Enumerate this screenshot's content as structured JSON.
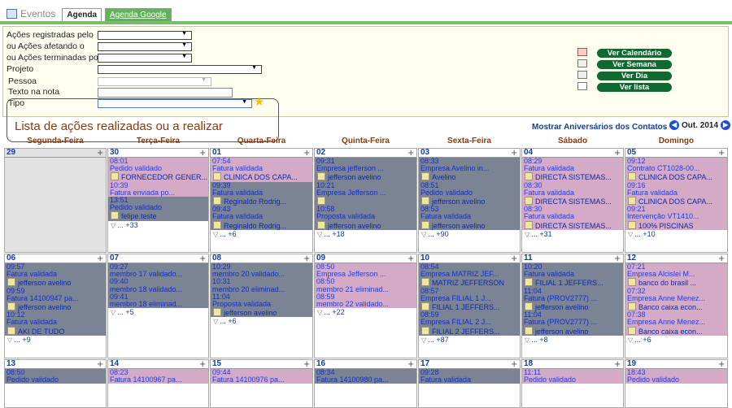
{
  "tabs": {
    "eventos": "Eventos",
    "agenda": "Agenda",
    "google": "Agenda Google"
  },
  "filters": {
    "registradas": "Ações registradas pelo",
    "afetando": "ou Ações afetando o",
    "terminadas": "ou Ações terminadas por",
    "projeto": "Projeto",
    "pessoa": "Pessoa",
    "texto": "Texto na nota",
    "tipo": "Tipo"
  },
  "views": [
    "Ver Calendário",
    "Ver Semana",
    "Ver Dia",
    "Ver lista"
  ],
  "list_title": "Lista de ações realizadas ou a realizar",
  "aniversarios": "Mostrar Aniversários dos Contatos",
  "month": "Out. 2014",
  "weekdays": [
    "Segunda-Feira",
    "Terça-Feira",
    "Quarta-Feira",
    "Quinta-Feira",
    "Sexta-Feira",
    "Sábado",
    "Domingo"
  ],
  "weeks": [
    [
      {
        "day": "29",
        "gray": true,
        "events": [],
        "more": ""
      },
      {
        "day": "30",
        "events": [
          {
            "c": "pink",
            "t": "08:01",
            "d": "Pedido validado",
            "w": "FORNECEDOR GENER..."
          },
          {
            "c": "pink",
            "t": "10:39",
            "d": "Fatura enviada po..."
          },
          {
            "c": "blue",
            "t": "13:51",
            "d": "Pedido validado",
            "w": "felipe.teste"
          }
        ],
        "more": "... +33"
      },
      {
        "day": "01",
        "events": [
          {
            "c": "pink",
            "t": "07:54",
            "d": "Fatura validada",
            "w": "CLINICA DOS CAPA..."
          },
          {
            "c": "blue",
            "t": "09:39",
            "d": "Fatura validada",
            "w": "Reginaldo Rodrig..."
          },
          {
            "c": "blue",
            "t": "09:43",
            "d": "Fatura validada",
            "w": "Reginaldo Rodrig..."
          }
        ],
        "more": "... +6"
      },
      {
        "day": "02",
        "events": [
          {
            "c": "blue",
            "t": "09:31",
            "d": "Empresa jefferson ...",
            "w": "jefferson avelino"
          },
          {
            "c": "blue",
            "t": "10:21",
            "d": "Empresa Jefferson ...",
            "w": " "
          },
          {
            "c": "blue",
            "t": "10:58",
            "d": "Proposta validada",
            "w": "jefferson avelino"
          }
        ],
        "more": "... +18"
      },
      {
        "day": "03",
        "events": [
          {
            "c": "blue",
            "t": "08:33",
            "d": "Empresa Avelino in...",
            "w": "Avelino"
          },
          {
            "c": "blue",
            "t": "08:51",
            "d": "Pedido validado",
            "w": "jefferson avelino"
          },
          {
            "c": "blue",
            "t": "08:53",
            "d": "Fatura validada",
            "w": "jefferson avelino"
          }
        ],
        "more": "... +90"
      },
      {
        "day": "04",
        "events": [
          {
            "c": "pink",
            "t": "08:29",
            "d": "Fatura validada",
            "w": "DIRECTA SISTEMAS..."
          },
          {
            "c": "pink",
            "t": "08:30",
            "d": "Fatura validada",
            "w": "DIRECTA SISTEMAS..."
          },
          {
            "c": "pink",
            "t": "08:30",
            "d": "Fatura validada",
            "w": "DIRECTA SISTEMAS..."
          }
        ],
        "more": "... +31"
      },
      {
        "day": "05",
        "events": [
          {
            "c": "pink",
            "t": "09:12",
            "d": "Contrato CT1028-00...",
            "w": "CLINICA DOS CAPA..."
          },
          {
            "c": "pink",
            "t": "09:16",
            "d": "Fatura validada",
            "w": "CLINICA DOS CAPA..."
          },
          {
            "c": "pink",
            "t": "09:21",
            "d": "Intervenção VT1410...",
            "w": "100% PISCINAS"
          }
        ],
        "more": "... +10"
      }
    ],
    [
      {
        "day": "06",
        "events": [
          {
            "c": "blue",
            "t": "09:57",
            "d": "Fatura validada",
            "w": "jefferson avelino"
          },
          {
            "c": "blue",
            "t": "09:59",
            "d": "Fatura 14100947 pa...",
            "w": "jefferson avelino"
          },
          {
            "c": "blue",
            "t": "10:12",
            "d": "Fatura validada",
            "w": "AKI DE TUDO"
          }
        ],
        "more": "... +9"
      },
      {
        "day": "07",
        "events": [
          {
            "c": "blue",
            "t": "09:27",
            "d": "membro 17 validado..."
          },
          {
            "c": "blue",
            "t": "09:40",
            "d": "membro 18 validado..."
          },
          {
            "c": "blue",
            "t": "09:41",
            "d": "membro 18 eliminad..."
          }
        ],
        "more": "... +5"
      },
      {
        "day": "08",
        "events": [
          {
            "c": "blue",
            "t": "10:29",
            "d": "membro 20 validado..."
          },
          {
            "c": "blue",
            "t": "10:31",
            "d": "membro 20 eliminad..."
          },
          {
            "c": "blue",
            "t": "11:04",
            "d": "Proposta validada",
            "w": "jefferson avelino"
          }
        ],
        "more": "... +6"
      },
      {
        "day": "09",
        "events": [
          {
            "c": "pink",
            "t": "08:50",
            "d": "Empresa Jefferson ..."
          },
          {
            "c": "pink",
            "t": "08:50",
            "d": "membro 21 eliminad..."
          },
          {
            "c": "pink",
            "t": "08:59",
            "d": "membro 22 validado..."
          }
        ],
        "more": "... +22"
      },
      {
        "day": "10",
        "events": [
          {
            "c": "blue",
            "t": "08:54",
            "d": "Empresa MATRIZ JEF...",
            "w": "MATRIZ JEFFERSON"
          },
          {
            "c": "blue",
            "t": "08:57",
            "d": "Empresa FILIAL 1 J...",
            "w": "FILIAL 1 JEFFERS..."
          },
          {
            "c": "blue",
            "t": "08:59",
            "d": "Empresa FILIAL 2 J...",
            "w": "FILIAL 2 JEFFERS..."
          }
        ],
        "more": "... +87"
      },
      {
        "day": "11",
        "events": [
          {
            "c": "blue",
            "t": "10:20",
            "d": "Fatura validada",
            "w": "FILIAL 1 JEFFERS..."
          },
          {
            "c": "blue",
            "t": "11:04",
            "d": "Fatura (PROV2777) ...",
            "w": "jefferson avelino"
          },
          {
            "c": "blue",
            "t": "11:04",
            "d": "Fatura (PROV2777) ...",
            "w": "jefferson avelino"
          }
        ],
        "more": "... +8"
      },
      {
        "day": "12",
        "events": [
          {
            "c": "pink",
            "t": "07:21",
            "d": "Empresa Alcislei M...",
            "w": "banco do brasil ..."
          },
          {
            "c": "pink",
            "t": "07:32",
            "d": "Empresa Anne Menez...",
            "w": "Banco caixa econ..."
          },
          {
            "c": "pink",
            "t": "07:38",
            "d": "Empresa Anne Menez...",
            "w": "Banco caixa econ..."
          }
        ],
        "more": "... +6"
      }
    ],
    [
      {
        "day": "13",
        "events": [
          {
            "c": "blue",
            "t": "08:50",
            "d": "Pedido validado"
          }
        ],
        "more": ""
      },
      {
        "day": "14",
        "events": [
          {
            "c": "pink",
            "t": "08:23",
            "d": "Fatura 14100967 pa..."
          }
        ],
        "more": ""
      },
      {
        "day": "15",
        "events": [
          {
            "c": "pink",
            "t": "09:44",
            "d": "Fatura 14100976 pa..."
          }
        ],
        "more": ""
      },
      {
        "day": "16",
        "events": [
          {
            "c": "blue",
            "t": "08:34",
            "d": "Fatura 14100980 pa..."
          }
        ],
        "more": ""
      },
      {
        "day": "17",
        "events": [
          {
            "c": "blue",
            "t": "09:28",
            "d": "Fatura validada"
          }
        ],
        "more": ""
      },
      {
        "day": "18",
        "events": [
          {
            "c": "pink",
            "t": "11:11",
            "d": "Pedido validado"
          }
        ],
        "more": ""
      },
      {
        "day": "19",
        "events": [
          {
            "c": "pink",
            "t": "18:43",
            "d": "Pedido validado"
          }
        ],
        "more": ""
      }
    ]
  ]
}
